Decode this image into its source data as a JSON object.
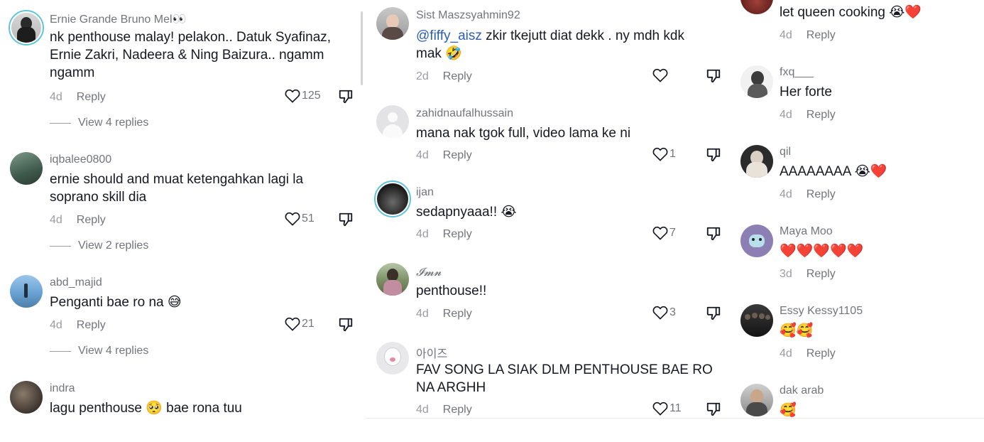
{
  "col1": [
    {
      "username": "Ernie Grande Bruno Mel👀",
      "text": "nk penthouse malay! pelakon.. Datuk Syafinaz, Ernie Zakri, Nadeera & Ning Baizura.. ngamm ngamm",
      "time": "4d",
      "reply": "Reply",
      "likes": "125",
      "view_replies": "View 4 replies"
    },
    {
      "username": "iqbalee0800",
      "text": "ernie should and muat ketengahkan lagi la soprano skill dia",
      "time": "4d",
      "reply": "Reply",
      "likes": "51",
      "view_replies": "View 2 replies"
    },
    {
      "username": "abd_majid",
      "text": "Penganti bae ro na 😅",
      "time": "4d",
      "reply": "Reply",
      "likes": "21",
      "view_replies": "View 4 replies"
    },
    {
      "username": "indra",
      "text": "lagu penthouse 🥺 bae rona tuu"
    }
  ],
  "col2": [
    {
      "username": "Sist Maszsyahmin92",
      "mention": "@fiffy_aisz",
      "text": " zkir tkejutt diat dekk . ny mdh kdk mak 🤣",
      "time": "2d",
      "reply": "Reply",
      "likes": ""
    },
    {
      "username": "zahidnaufalhussain",
      "text": "mana nak tgok full, video lama ke ni",
      "time": "4d",
      "reply": "Reply",
      "likes": "1"
    },
    {
      "username": "ijan",
      "text": "sedapnyaaa!! 😭",
      "time": "4d",
      "reply": "Reply",
      "likes": "7"
    },
    {
      "username": "𝓘𝓶𝓷",
      "text": "penthouse!!",
      "time": "4d",
      "reply": "Reply",
      "likes": "3"
    },
    {
      "username": "아이즈",
      "text": "FAV SONG LA SIAK DLM PENTHOUSE BAE RO NA ARGHH",
      "time": "4d",
      "reply": "Reply",
      "likes": "11"
    }
  ],
  "col3": [
    {
      "username": "",
      "text": "let queen cooking 😭❤️",
      "time": "4d",
      "reply": "Reply"
    },
    {
      "username": "fxq___",
      "text": "Her forte",
      "time": "4d",
      "reply": "Reply"
    },
    {
      "username": "qil",
      "text": "AAAAAAAA 😭❤️",
      "time": "4d",
      "reply": "Reply"
    },
    {
      "username": "Maya Moo",
      "text": "❤️❤️❤️❤️❤️",
      "time": "3d",
      "reply": "Reply"
    },
    {
      "username": "Essy Kessy1105",
      "text": "🥰🥰",
      "time": "4d",
      "reply": "Reply"
    },
    {
      "username": "dak arab",
      "text": "🥰"
    }
  ],
  "icons": {
    "like": "heart-outline-icon",
    "dislike": "thumbs-down-icon"
  },
  "colors": {
    "username": "#73757c",
    "text": "#161823",
    "mention": "#2b5db8",
    "ring": "#5fc5dc",
    "heart": "#e2231a"
  }
}
